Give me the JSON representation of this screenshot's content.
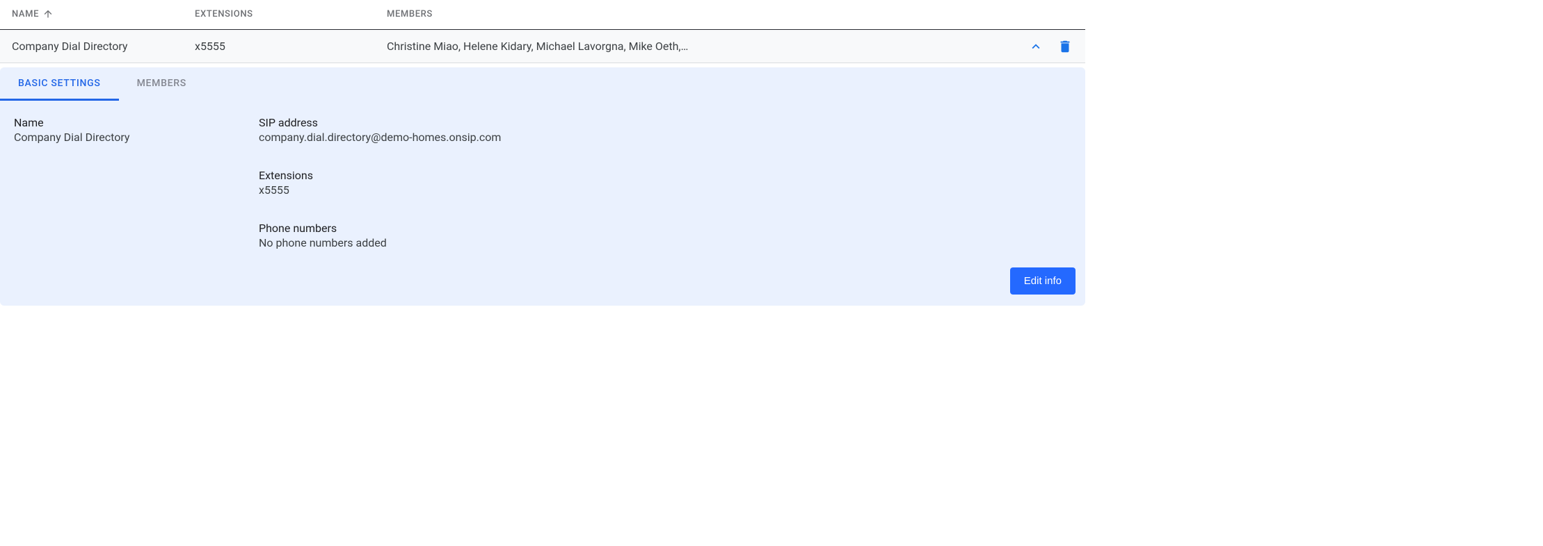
{
  "table": {
    "headers": {
      "name": "NAME",
      "extensions": "EXTENSIONS",
      "members": "MEMBERS"
    },
    "sort": {
      "column": "name",
      "direction": "asc"
    },
    "row": {
      "name": "Company Dial Directory",
      "extensions": "x5555",
      "members": "Christine Miao, Helene Kidary, Michael Lavorgna, Mike Oeth,…"
    }
  },
  "tabs": {
    "basic": "BASIC SETTINGS",
    "members": "MEMBERS",
    "active": "basic"
  },
  "details": {
    "name_label": "Name",
    "name_value": "Company Dial Directory",
    "sip_label": "SIP address",
    "sip_value": "company.dial.directory@demo-homes.onsip.com",
    "ext_label": "Extensions",
    "ext_value": "x5555",
    "phone_label": "Phone numbers",
    "phone_value": "No phone numbers added"
  },
  "buttons": {
    "edit_info": "Edit info"
  }
}
